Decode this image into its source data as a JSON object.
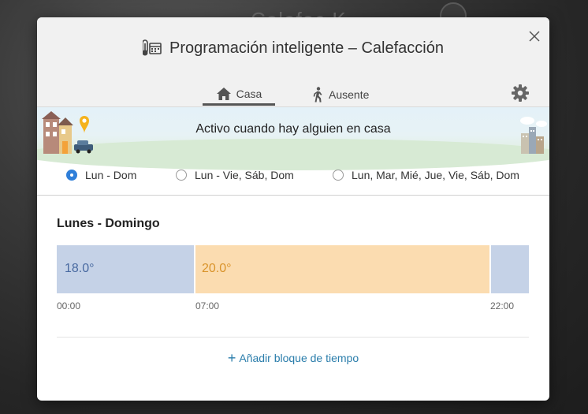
{
  "background": {
    "app_title": "Calefac K"
  },
  "modal": {
    "title": "Programación inteligente – Calefacción",
    "tabs": [
      {
        "label": "Casa",
        "icon": "home-icon",
        "active": true
      },
      {
        "label": "Ausente",
        "icon": "walking-person-icon",
        "active": false
      }
    ],
    "banner_text": "Activo cuando hay alguien en casa",
    "day_options": [
      {
        "label": "Lun - Dom",
        "checked": true
      },
      {
        "label": "Lun - Vie, Sáb, Dom",
        "checked": false
      },
      {
        "label": "Lun, Mar, Mié, Jue, Vie, Sáb, Dom",
        "checked": false
      }
    ],
    "section_title": "Lunes - Domingo",
    "blocks": [
      {
        "temp": "18.0°",
        "start": "00:00"
      },
      {
        "temp": "20.0°",
        "start": "07:00"
      },
      {
        "temp": "",
        "start": "22:00"
      }
    ],
    "add_block_label": "Añadir bloque de tiempo"
  },
  "colors": {
    "accent_blue": "#2f7fd9",
    "block_cool": "#c5d2e7",
    "block_warm": "#fbdcb0",
    "link": "#2a7dab"
  }
}
